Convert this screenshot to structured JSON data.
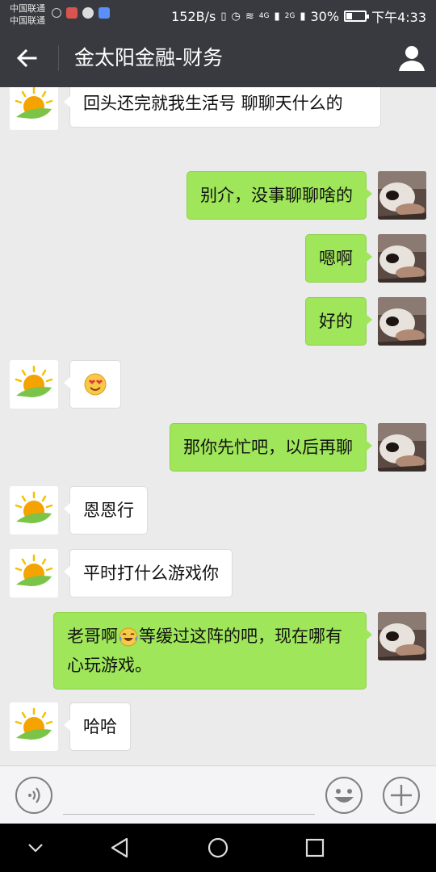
{
  "status_bar": {
    "carrier_1": "中国联通",
    "carrier_2": "中国联通",
    "net_speed": "152B/s",
    "sig1_label": "4G",
    "sig2_label": "2G",
    "battery_percent": "30%",
    "battery_level": 0.3,
    "time": "下午4:33"
  },
  "header": {
    "title": "金太阳金融-财务",
    "back_icon": "arrow-left-icon",
    "profile_icon": "person-icon"
  },
  "messages": [
    {
      "from": "them",
      "text": "回头还完就我生活号  聊聊天什么的"
    },
    {
      "from": "me",
      "text": "别介，没事聊聊啥的"
    },
    {
      "from": "me",
      "text": "嗯啊"
    },
    {
      "from": "me",
      "text": "好的"
    },
    {
      "from": "them",
      "emoji": "heart-eyes-emoji"
    },
    {
      "from": "me",
      "text": "那你先忙吧，以后再聊"
    },
    {
      "from": "them",
      "text": "恩恩行"
    },
    {
      "from": "them",
      "text": "平时打什么游戏你"
    },
    {
      "from": "me",
      "text_a": "老哥啊",
      "emoji": "tears-of-joy-emoji",
      "text_b": "等缓过这阵的吧，现在哪有心玩游戏。"
    },
    {
      "from": "them",
      "text": "哈哈"
    }
  ],
  "input_bar": {
    "voice_icon": "voice-icon",
    "placeholder": "",
    "emoji_icon": "smiley-icon",
    "plus_icon": "plus-icon"
  },
  "nav_bar": {
    "icons": [
      "chevron-down-icon",
      "back-triangle-icon",
      "home-circle-icon",
      "recents-square-icon"
    ]
  },
  "colors": {
    "header_bg": "#393a3f",
    "chat_bg": "#ebebeb",
    "my_bubble": "#9fe65a",
    "their_bubble": "#ffffff"
  }
}
